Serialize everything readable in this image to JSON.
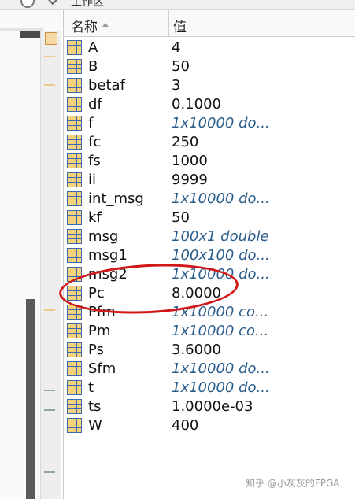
{
  "window": {
    "title": "工作区"
  },
  "workspace": {
    "columns": {
      "name": "名称",
      "value": "值"
    },
    "rows": [
      {
        "name": "A",
        "value": "4",
        "italic": false
      },
      {
        "name": "B",
        "value": "50",
        "italic": false
      },
      {
        "name": "betaf",
        "value": "3",
        "italic": false
      },
      {
        "name": "df",
        "value": "0.1000",
        "italic": false
      },
      {
        "name": "f",
        "value": "1x10000 do...",
        "italic": true
      },
      {
        "name": "fc",
        "value": "250",
        "italic": false
      },
      {
        "name": "fs",
        "value": "1000",
        "italic": false
      },
      {
        "name": "ii",
        "value": "9999",
        "italic": false
      },
      {
        "name": "int_msg",
        "value": "1x10000 do...",
        "italic": true
      },
      {
        "name": "kf",
        "value": "50",
        "italic": false
      },
      {
        "name": "msg",
        "value": "100x1 double",
        "italic": true
      },
      {
        "name": "msg1",
        "value": "100x100 do...",
        "italic": true
      },
      {
        "name": "msg2",
        "value": "1x10000 do...",
        "italic": true
      },
      {
        "name": "Pc",
        "value": "8.0000",
        "italic": false
      },
      {
        "name": "Pfm",
        "value": "1x10000 co...",
        "italic": true
      },
      {
        "name": "Pm",
        "value": "1x10000 co...",
        "italic": true
      },
      {
        "name": "Ps",
        "value": "3.6000",
        "italic": false
      },
      {
        "name": "Sfm",
        "value": "1x10000 do...",
        "italic": true
      },
      {
        "name": "t",
        "value": "1x10000 do...",
        "italic": true
      },
      {
        "name": "ts",
        "value": "1.0000e-03",
        "italic": false
      },
      {
        "name": "W",
        "value": "400",
        "italic": false
      }
    ]
  },
  "annotation": {
    "highlighted_row": "Pc",
    "color": "#d01818"
  },
  "watermark": "知乎 @小灰灰的FPGA",
  "colors": {
    "italic_value": "#2b5d8c",
    "icon_fill": "#f7d27a",
    "icon_border": "#3a6ab0"
  }
}
